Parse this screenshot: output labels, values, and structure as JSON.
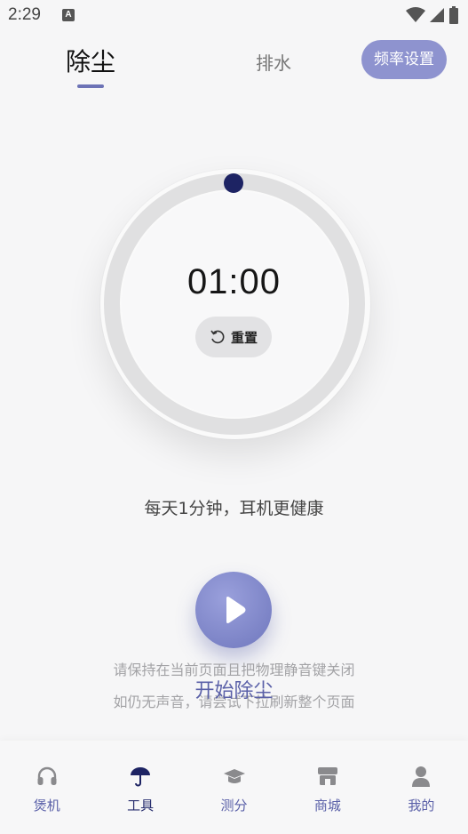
{
  "status_bar": {
    "time": "2:29",
    "notification_icon": "A"
  },
  "header": {
    "tabs": [
      {
        "label": "除尘",
        "active": true
      },
      {
        "label": "排水",
        "active": false
      }
    ],
    "freq_button_label": "频率设置"
  },
  "timer": {
    "display": "01:00",
    "reset_label": "重置",
    "progress": 0.0
  },
  "tip": "每天1分钟，耳机更健康",
  "start": {
    "label": "开始除尘",
    "hint_line1": "请保持在当前页面且把物理静音键关闭",
    "hint_line2": "如仍无声音，请尝试下拉刷新整个页面"
  },
  "bottom_nav": {
    "items": [
      {
        "label": "煲机",
        "icon": "headphones-icon",
        "active": false
      },
      {
        "label": "工具",
        "icon": "umbrella-icon",
        "active": true
      },
      {
        "label": "测分",
        "icon": "graduation-cap-icon",
        "active": false
      },
      {
        "label": "商城",
        "icon": "store-icon",
        "active": false
      },
      {
        "label": "我的",
        "icon": "user-icon",
        "active": false
      }
    ]
  },
  "colors": {
    "accent": "#6d73b6",
    "accent_dark": "#1d2363",
    "ring": "#e0e0e1",
    "background": "#f6f6f7"
  }
}
